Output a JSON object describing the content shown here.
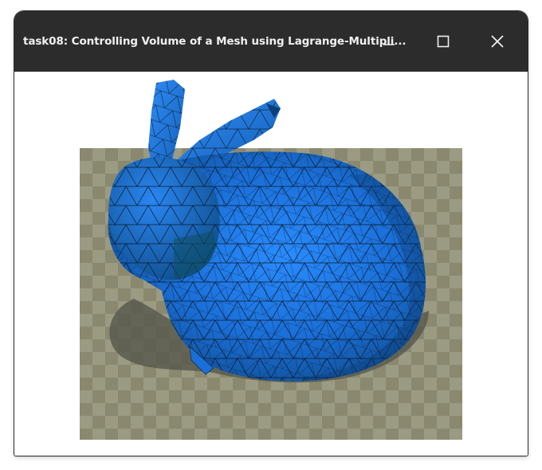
{
  "window": {
    "title": "task08: Controlling Volume of a Mesh using Lagrange-Multipli...",
    "buttons": {
      "minimize": "minimize-icon",
      "maximize": "maximize-icon",
      "close": "close-icon"
    }
  },
  "viewport": {
    "background": "#ffffff",
    "floor": {
      "pattern": "checkerboard",
      "color_light": "#9b9a83",
      "color_dark": "#8a896f"
    },
    "object": {
      "name": "bunny-mesh",
      "face_color": "#1e7ff0",
      "edge_color": "#0a1a2e"
    }
  }
}
